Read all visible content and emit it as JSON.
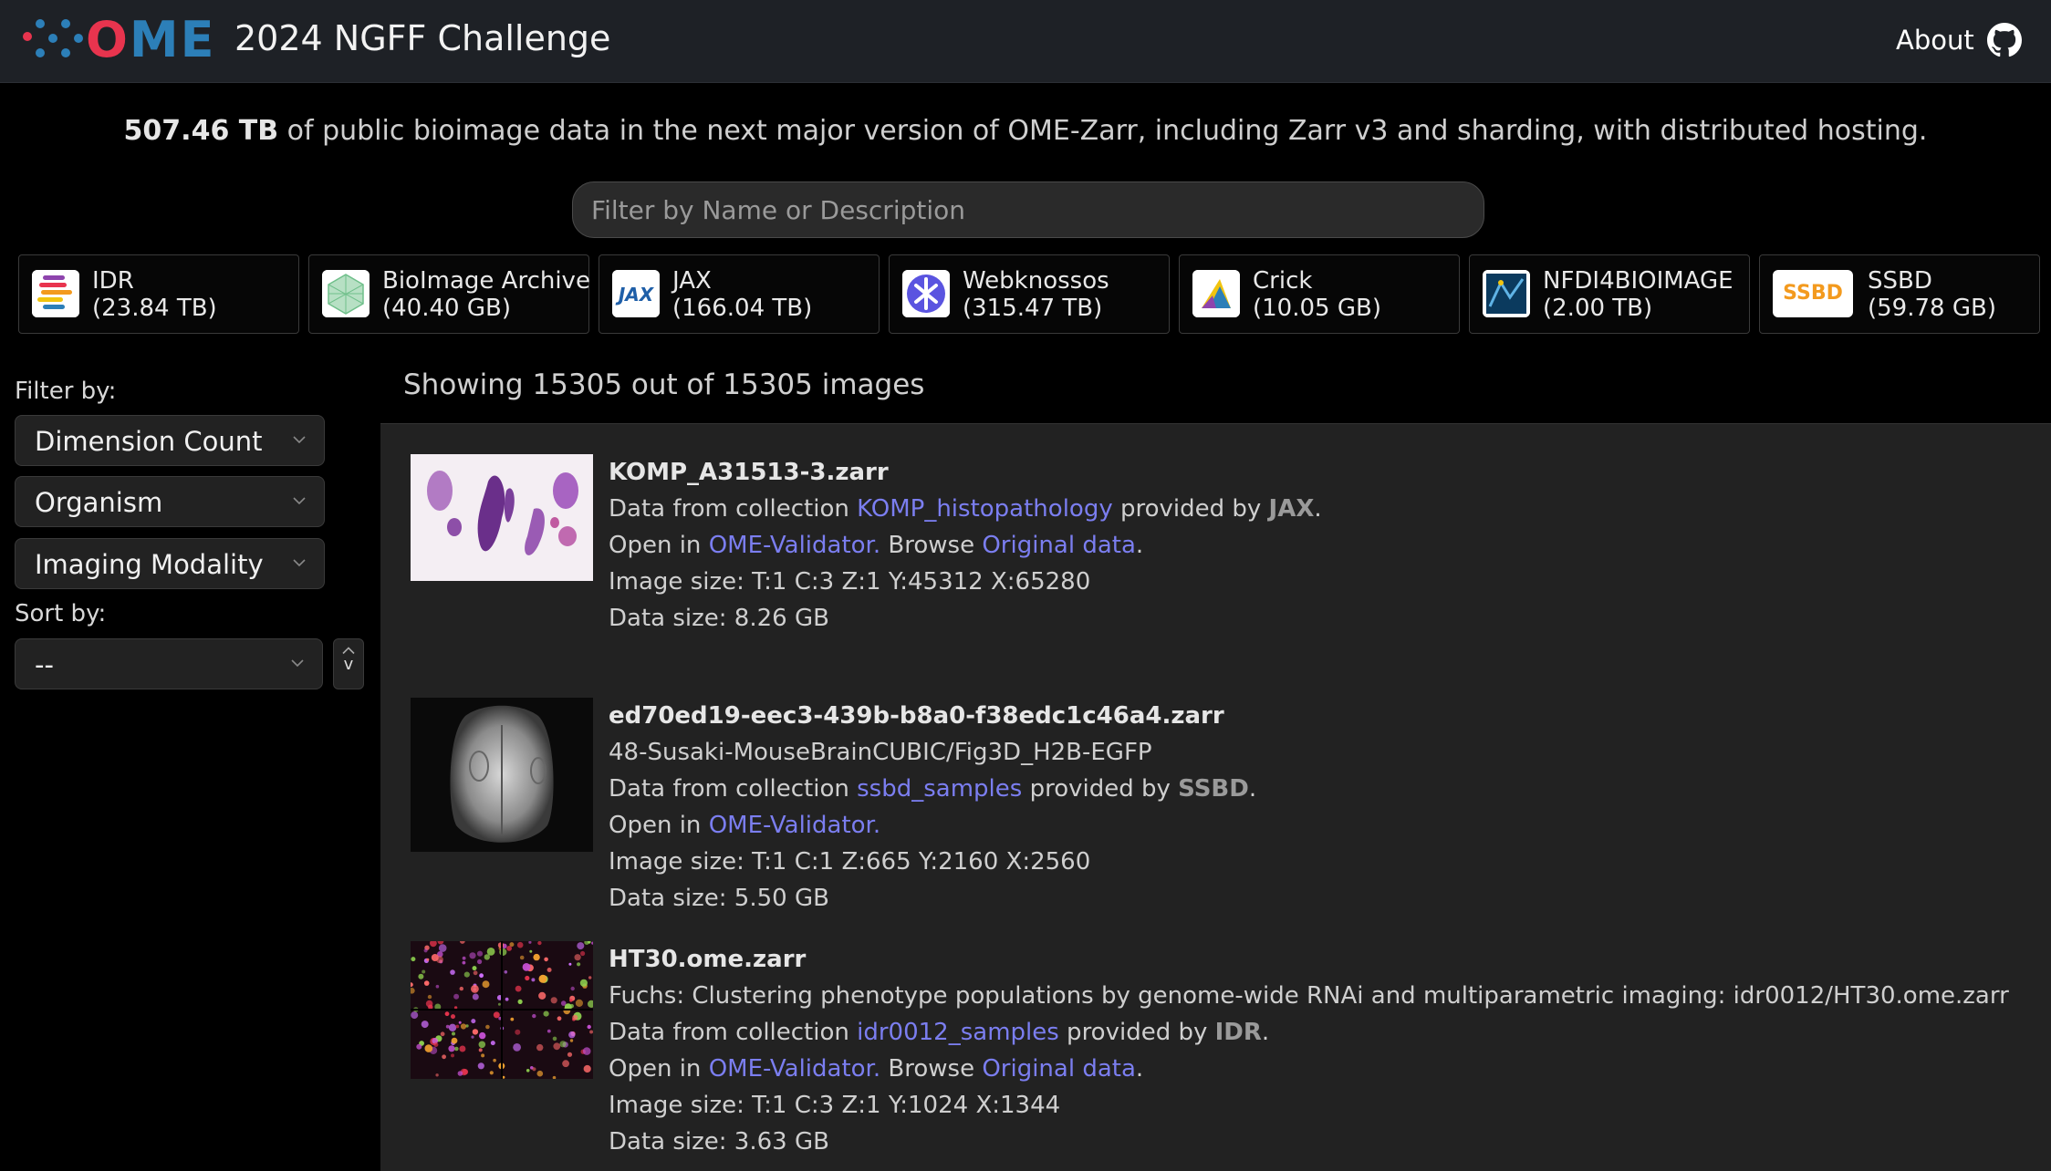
{
  "header": {
    "logo_text_o": "O",
    "logo_text_me": "ME",
    "title": "2024 NGFF Challenge",
    "about": "About",
    "github_icon": "github-icon"
  },
  "summary": {
    "amount": "507.46 TB",
    "text": " of public bioimage data in the next major version of OME-Zarr, including Zarr v3 and sharding, with distributed hosting."
  },
  "search": {
    "placeholder": "Filter by Name or Description"
  },
  "sources": [
    {
      "name": "IDR",
      "size": "(23.84 TB)",
      "icon": "idr-logo"
    },
    {
      "name": "BioImage Archive",
      "size": "(40.40 GB)",
      "icon": "bioimage-archive-logo"
    },
    {
      "name": "JAX",
      "size": "(166.04 TB)",
      "icon": "jax-logo"
    },
    {
      "name": "Webknossos",
      "size": "(315.47 TB)",
      "icon": "webknossos-logo"
    },
    {
      "name": "Crick",
      "size": "(10.05 GB)",
      "icon": "crick-logo"
    },
    {
      "name": "NFDI4BIOIMAGE",
      "size": "(2.00 TB)",
      "icon": "nfdi4bioimage-logo"
    },
    {
      "name": "SSBD",
      "size": "(59.78 GB)",
      "icon": "ssbd-logo",
      "icon_text": "SSBD"
    }
  ],
  "sidebar": {
    "filter_label": "Filter by:",
    "filters": [
      "Dimension Count",
      "Organism",
      "Imaging Modality"
    ],
    "sort_label": "Sort by:",
    "sort_value": "--",
    "sort_direction": "v"
  },
  "main": {
    "showing": "Showing 15305 out of 15305 images",
    "items": [
      {
        "name": "KOMP_A31513-3.zarr",
        "description": "",
        "collection_prefix": "Data from collection ",
        "collection": "KOMP_histopathology",
        "provided_by": " provided by ",
        "provider": "JAX",
        "open_in": "Open in ",
        "validator": "OME-Validator.",
        "browse": " Browse ",
        "original": "Original data",
        "image_size": "Image size: T:1  C:3  Z:1  Y:45312  X:65280",
        "data_size": "Data size: 8.26 GB"
      },
      {
        "name": "ed70ed19-eec3-439b-b8a0-f38edc1c46a4.zarr",
        "description": "48-Susaki-MouseBrainCUBIC/Fig3D_H2B-EGFP",
        "collection_prefix": "Data from collection ",
        "collection": "ssbd_samples",
        "provided_by": " provided by ",
        "provider": "SSBD",
        "open_in": "Open in ",
        "validator": "OME-Validator.",
        "browse": "",
        "original": "",
        "image_size": "Image size: T:1  C:1  Z:665  Y:2160  X:2560",
        "data_size": "Data size: 5.50 GB"
      },
      {
        "name": "HT30.ome.zarr",
        "description": "Fuchs: Clustering phenotype populations by genome-wide RNAi and multiparametric imaging: idr0012/HT30.ome.zarr",
        "collection_prefix": "Data from collection ",
        "collection": "idr0012_samples",
        "provided_by": " provided by ",
        "provider": "IDR",
        "open_in": "Open in ",
        "validator": "OME-Validator.",
        "browse": " Browse ",
        "original": "Original data",
        "image_size": "Image size: T:1  C:3  Z:1  Y:1024  X:1344",
        "data_size": "Data size: 3.63 GB"
      }
    ]
  },
  "colors": {
    "link": "#7b7ef0",
    "ssbd_orange": "#f39a1e",
    "ome_red": "#e8344e",
    "ome_blue": "#2c7fb8"
  }
}
